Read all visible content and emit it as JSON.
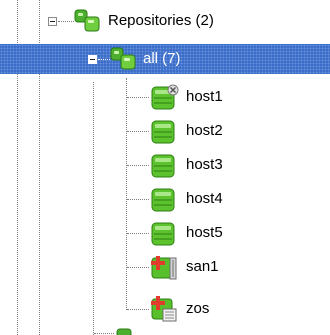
{
  "tree": {
    "repositories": {
      "label": "Repositories (2)",
      "icon": "repository-group-icon"
    },
    "all": {
      "label": "all (7)",
      "icon": "repository-group-icon",
      "selected_color": "#3166c7"
    },
    "hosts": [
      {
        "label": "host1",
        "icon": "host-disconnected-icon"
      },
      {
        "label": "host2",
        "icon": "host-icon"
      },
      {
        "label": "host3",
        "icon": "host-icon"
      },
      {
        "label": "host4",
        "icon": "host-icon"
      },
      {
        "label": "host5",
        "icon": "host-icon"
      },
      {
        "label": "san1",
        "icon": "san-icon"
      },
      {
        "label": "zos",
        "icon": "zos-icon"
      }
    ]
  }
}
